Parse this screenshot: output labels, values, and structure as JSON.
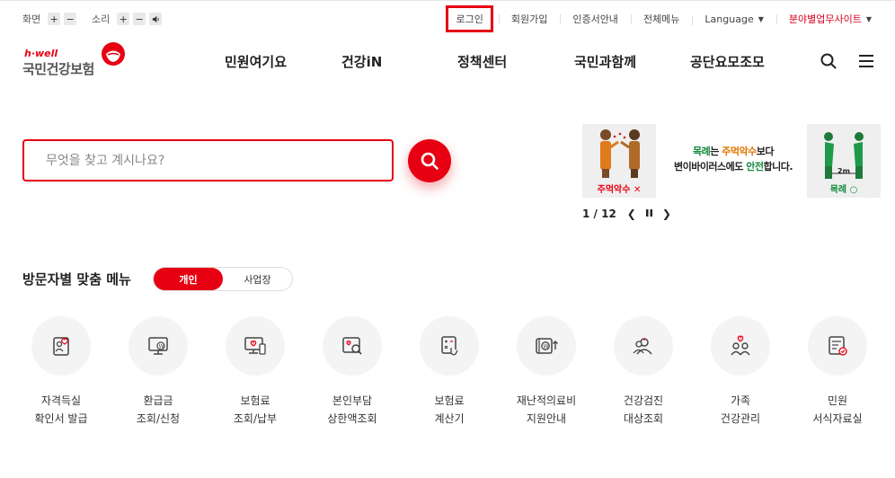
{
  "utility": {
    "screen_label": "화면",
    "sound_label": "소리",
    "plus": "+",
    "minus": "−",
    "links": {
      "login": "로그인",
      "join": "회원가입",
      "cert": "인증서안내",
      "allmenu": "전체메뉴",
      "language": "Language",
      "sites": "분야별업무사이트"
    }
  },
  "logo": {
    "tagline": "h·well",
    "name": "국민건강보험"
  },
  "gnb": [
    "민원여기요",
    "건강iN",
    "정책센터",
    "국민과함께",
    "공단요모조모"
  ],
  "search": {
    "placeholder": "무엇을 찾고 계시나요?"
  },
  "banner": {
    "left_caption": "주먹악수 ✕",
    "right_caption": "목례 ○",
    "distance": "2m",
    "line1_a": "목례",
    "line1_b": "는 ",
    "line1_c": "주먹악수",
    "line1_d": "보다",
    "line2_a": "변이바이러스에도 ",
    "line2_b": "안전",
    "line2_c": "합니다.",
    "counter": "1 / 12"
  },
  "visitor_menu": {
    "title": "방문자별 맞춤 메뉴",
    "tabs": [
      "개인",
      "사업장"
    ],
    "items": [
      {
        "l1": "자격득실",
        "l2": "확인서 발급"
      },
      {
        "l1": "환급금",
        "l2": "조회/신청"
      },
      {
        "l1": "보험료",
        "l2": "조회/납부"
      },
      {
        "l1": "본인부담",
        "l2": "상한액조회"
      },
      {
        "l1": "보험료",
        "l2": "계산기"
      },
      {
        "l1": "재난적의료비",
        "l2": "지원안내"
      },
      {
        "l1": "건강검진",
        "l2": "대상조회"
      },
      {
        "l1": "가족",
        "l2": "건강관리"
      },
      {
        "l1": "민원",
        "l2": "서식자료실"
      }
    ]
  },
  "colors": {
    "accent": "#e60012",
    "banner_green": "#148a3c",
    "banner_orange": "#e07400"
  }
}
